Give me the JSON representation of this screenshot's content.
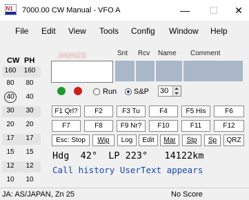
{
  "window": {
    "title": "7000.00 CW Manual - VFO A",
    "minimize_glyph": "—",
    "maximize_glyph": "☐",
    "close_glyph": "✕"
  },
  "menu": [
    "File",
    "Edit",
    "View",
    "Tools",
    "Config",
    "Window",
    "Help"
  ],
  "bands": {
    "headers": [
      "CW",
      "PH"
    ],
    "rows": [
      [
        "160",
        "160"
      ],
      [
        "80",
        "80"
      ],
      [
        "40",
        "40"
      ],
      [
        "30",
        "30"
      ],
      [
        "20",
        "20"
      ],
      [
        "17",
        "17"
      ],
      [
        "15",
        "15"
      ],
      [
        "12",
        "12"
      ],
      [
        "10",
        "10"
      ]
    ],
    "selected": "40"
  },
  "entry": {
    "call_value": "JH2NZS",
    "columns": [
      "Snt",
      "Rcv",
      "Name",
      "Comment"
    ]
  },
  "mode": {
    "run_label": "Run",
    "sp_label": "S&P",
    "selected": "S&P",
    "speed": "30"
  },
  "function_keys": {
    "row1": [
      "F1 Qrl?",
      "F2",
      "F3 Tu",
      "F4",
      "F5 His",
      "F6"
    ],
    "row2": [
      "F7",
      "F8",
      "F9 Nr?",
      "F10",
      "F11",
      "F12"
    ],
    "row3": [
      "Esc: Stop",
      "Wip",
      "Log",
      "Edit",
      "Mar",
      "Stp",
      "Sp",
      "QRZ"
    ]
  },
  "info": {
    "heading_line": "Hdg  42°  LP 223°   14122km",
    "user_text": "Call history UserText appears"
  },
  "status": {
    "left": "JA: AS/JAPAN, Zn 25",
    "score": "No Score"
  },
  "colors": {
    "field_bg": "#aab7c8",
    "led_green": "#1f9a2e",
    "led_red": "#d11c1c",
    "user_text": "#1846b0"
  }
}
